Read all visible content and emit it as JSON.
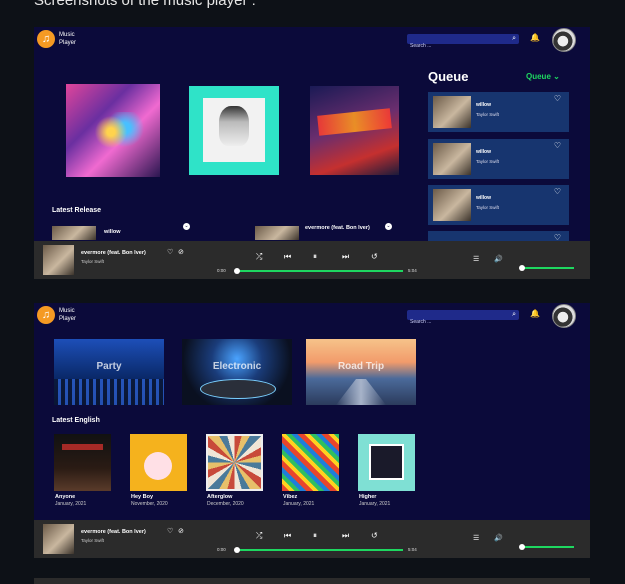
{
  "caption": "Screenshots of the music player :",
  "app": {
    "brand_line1": "Music",
    "brand_line2": "Player",
    "search_placeholder": "Search ...",
    "icons": {
      "logo": "music-note-icon",
      "search": "search-icon",
      "bell": "bell-icon"
    }
  },
  "screen1": {
    "queue_title": "Queue",
    "queue_select": "Queue",
    "queue_items": [
      {
        "title": "willow",
        "artist": "Taylor Swift"
      },
      {
        "title": "willow",
        "artist": "Taylor Swift"
      },
      {
        "title": "willow",
        "artist": "Taylor Swift"
      }
    ],
    "latest_release_title": "Latest Release",
    "latest_release": [
      {
        "title": "willow"
      },
      {
        "title": "evermore (feat. Bon Iver)"
      }
    ]
  },
  "screen2": {
    "genres": [
      {
        "label": "Party"
      },
      {
        "label": "Electronic"
      },
      {
        "label": "Road Trip"
      }
    ],
    "latest_english_title": "Latest English",
    "albums": [
      {
        "title": "Anyone",
        "date": "January, 2021"
      },
      {
        "title": "Hey Boy",
        "date": "November, 2020"
      },
      {
        "title": "Afterglow",
        "date": "December, 2020"
      },
      {
        "title": "Vibez",
        "date": "January, 2021"
      },
      {
        "title": "Higher",
        "date": "January, 2021"
      }
    ]
  },
  "player": {
    "title": "evermore (feat. Bon Iver)",
    "artist": "Taylor Swift",
    "time_current": "0:00",
    "time_total": "5:04",
    "progress": 0,
    "volume": 0
  },
  "colors": {
    "accent": "#1ed760",
    "background": "#0b0a3a",
    "queue_item": "#17356f",
    "player_bar": "#2b2b2b",
    "logo": "#f59a23"
  }
}
